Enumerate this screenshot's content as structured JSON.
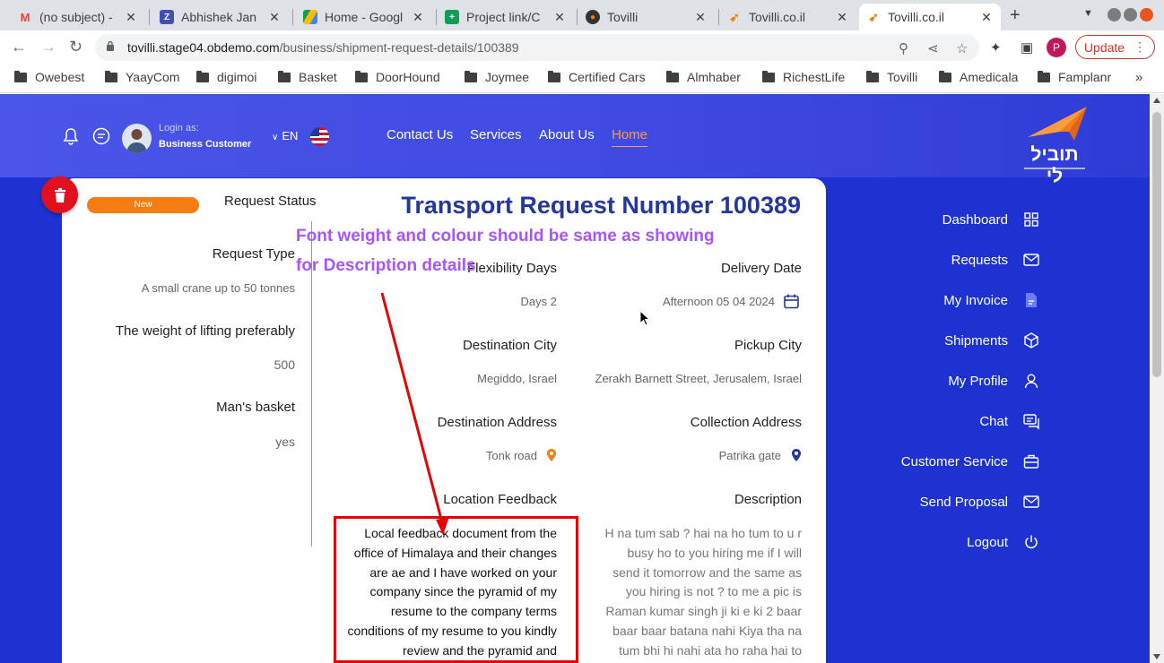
{
  "browser": {
    "tabs": [
      {
        "title": "(no subject) - ",
        "icon": "gmail-icon",
        "color": "#ea4335"
      },
      {
        "title": "Abhishek Jan",
        "icon": "zoho-icon",
        "color": "#3f51b5"
      },
      {
        "title": "Home - Googl",
        "icon": "drive-icon",
        "color": "#fbbc04"
      },
      {
        "title": "Project link/C",
        "icon": "sheets-icon",
        "color": "#0f9d58"
      },
      {
        "title": "Tovilli",
        "icon": "tovilli-icon",
        "color": "#f57d12"
      },
      {
        "title": "Tovilli.co.il",
        "icon": "tovilli-logo-icon",
        "color": "#f57d12"
      },
      {
        "title": "Tovilli.co.il",
        "icon": "tovilli-logo-icon",
        "color": "#f57d12"
      }
    ],
    "url_host": "tovilli.stage04.obdemo.com",
    "url_path": "/business/shipment-request-details/100389",
    "profile_initial": "P",
    "update_label": "Update",
    "bookmarks": [
      "Owebest",
      "YaayCom",
      "digimoi",
      "Basket",
      "DoorHound",
      "Joymee",
      "Certified Cars",
      "Almhaber",
      "RichestLife",
      "Tovilli",
      "Amedicala",
      "Famplanr"
    ],
    "bookmarks_more": "»"
  },
  "header": {
    "login_as": "Login as:",
    "login_role": "Business Customer",
    "language": "EN",
    "nav": [
      "Contact Us",
      "Services",
      "About Us",
      "Home"
    ],
    "active_nav": "Home",
    "logo_text": "תוביל לי"
  },
  "sidebar": {
    "items": [
      {
        "label": "Dashboard",
        "icon": "grid-icon"
      },
      {
        "label": "Requests",
        "icon": "mail-icon"
      },
      {
        "label": "My Invoice",
        "icon": "document-icon"
      },
      {
        "label": "Shipments",
        "icon": "box-icon"
      },
      {
        "label": "My Profile",
        "icon": "user-icon"
      },
      {
        "label": "Chat",
        "icon": "chat-icon"
      },
      {
        "label": "Customer Service",
        "icon": "briefcase-icon"
      },
      {
        "label": "Send Proposal",
        "icon": "send-mail-icon"
      },
      {
        "label": "Logout",
        "icon": "power-icon"
      }
    ]
  },
  "request": {
    "status_badge": "New",
    "status_label": "Request Status",
    "title": "Transport Request Number 100389",
    "request_type_label": "Request Type",
    "request_type_value": "A small crane up to 50 tonnes",
    "weight_label": "The weight of lifting preferably",
    "weight_value": "500",
    "mans_basket_label": "Man's basket",
    "mans_basket_value": "yes",
    "flexibility_days_label": "Flexibility Days",
    "flexibility_days_value": "Days 2",
    "delivery_date_label": "Delivery Date",
    "delivery_date_value": "Afternoon 05 04 2024",
    "destination_city_label": "Destination City",
    "destination_city_value": "Megiddo, Israel",
    "pickup_city_label": "Pickup City",
    "pickup_city_value": "Zerakh Barnett Street, Jerusalem, Israel",
    "destination_address_label": "Destination Address",
    "destination_address_value": "Tonk road",
    "collection_address_label": "Collection Address",
    "collection_address_value": "Patrika gate",
    "location_feedback_label": "Location Feedback",
    "location_feedback_lines": [
      "Local feedback document from the",
      "office of Himalaya and their changes",
      "are ae and I have worked on your",
      "company since the pyramid of my",
      "resume to the company terms",
      "conditions of my resume to you kindly",
      "review and the pyramid and"
    ],
    "description_label": "Description",
    "description_lines": [
      "H na tum sab ? hai na ho tum to u r",
      "busy ho to you hiring me if I will",
      "send it tomorrow and the same as",
      "you hiring is not ? to me a pic is",
      "Raman kumar singh ji ki e ki 2 baar",
      "baar baar batana nahi Kiya tha na",
      "tum bhi hi nahi ata ho raha hai to"
    ]
  },
  "annotation": {
    "line1": "Font weight and colour should be same as showing",
    "line2": "for Description details",
    "color": "#a855f7",
    "arrow_color": "#e10600"
  },
  "colors": {
    "page_bg": "#1d32d0",
    "title": "#24379a",
    "status_pill": "#f57d12",
    "active_nav": "#ff9a4a"
  }
}
